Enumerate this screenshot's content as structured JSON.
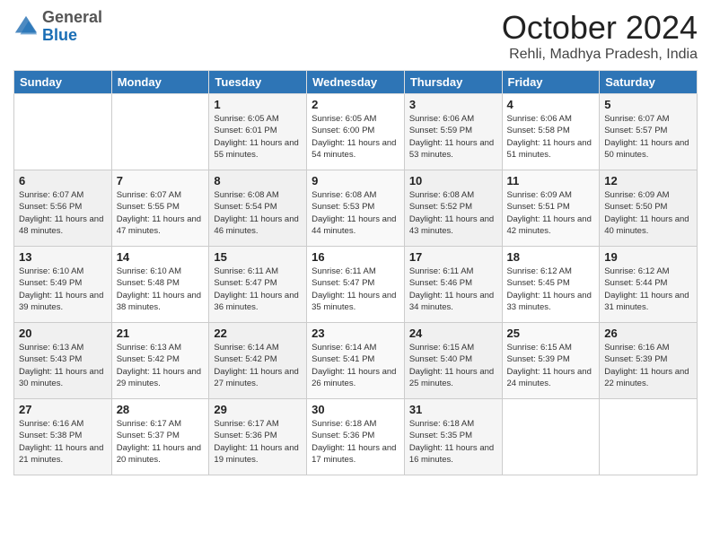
{
  "header": {
    "logo": {
      "general": "General",
      "blue": "Blue"
    },
    "title": "October 2024",
    "subtitle": "Rehli, Madhya Pradesh, India"
  },
  "days_of_week": [
    "Sunday",
    "Monday",
    "Tuesday",
    "Wednesday",
    "Thursday",
    "Friday",
    "Saturday"
  ],
  "weeks": [
    [
      {
        "day": "",
        "info": ""
      },
      {
        "day": "",
        "info": ""
      },
      {
        "day": "1",
        "info": "Sunrise: 6:05 AM\nSunset: 6:01 PM\nDaylight: 11 hours and 55 minutes."
      },
      {
        "day": "2",
        "info": "Sunrise: 6:05 AM\nSunset: 6:00 PM\nDaylight: 11 hours and 54 minutes."
      },
      {
        "day": "3",
        "info": "Sunrise: 6:06 AM\nSunset: 5:59 PM\nDaylight: 11 hours and 53 minutes."
      },
      {
        "day": "4",
        "info": "Sunrise: 6:06 AM\nSunset: 5:58 PM\nDaylight: 11 hours and 51 minutes."
      },
      {
        "day": "5",
        "info": "Sunrise: 6:07 AM\nSunset: 5:57 PM\nDaylight: 11 hours and 50 minutes."
      }
    ],
    [
      {
        "day": "6",
        "info": "Sunrise: 6:07 AM\nSunset: 5:56 PM\nDaylight: 11 hours and 48 minutes."
      },
      {
        "day": "7",
        "info": "Sunrise: 6:07 AM\nSunset: 5:55 PM\nDaylight: 11 hours and 47 minutes."
      },
      {
        "day": "8",
        "info": "Sunrise: 6:08 AM\nSunset: 5:54 PM\nDaylight: 11 hours and 46 minutes."
      },
      {
        "day": "9",
        "info": "Sunrise: 6:08 AM\nSunset: 5:53 PM\nDaylight: 11 hours and 44 minutes."
      },
      {
        "day": "10",
        "info": "Sunrise: 6:08 AM\nSunset: 5:52 PM\nDaylight: 11 hours and 43 minutes."
      },
      {
        "day": "11",
        "info": "Sunrise: 6:09 AM\nSunset: 5:51 PM\nDaylight: 11 hours and 42 minutes."
      },
      {
        "day": "12",
        "info": "Sunrise: 6:09 AM\nSunset: 5:50 PM\nDaylight: 11 hours and 40 minutes."
      }
    ],
    [
      {
        "day": "13",
        "info": "Sunrise: 6:10 AM\nSunset: 5:49 PM\nDaylight: 11 hours and 39 minutes."
      },
      {
        "day": "14",
        "info": "Sunrise: 6:10 AM\nSunset: 5:48 PM\nDaylight: 11 hours and 38 minutes."
      },
      {
        "day": "15",
        "info": "Sunrise: 6:11 AM\nSunset: 5:47 PM\nDaylight: 11 hours and 36 minutes."
      },
      {
        "day": "16",
        "info": "Sunrise: 6:11 AM\nSunset: 5:47 PM\nDaylight: 11 hours and 35 minutes."
      },
      {
        "day": "17",
        "info": "Sunrise: 6:11 AM\nSunset: 5:46 PM\nDaylight: 11 hours and 34 minutes."
      },
      {
        "day": "18",
        "info": "Sunrise: 6:12 AM\nSunset: 5:45 PM\nDaylight: 11 hours and 33 minutes."
      },
      {
        "day": "19",
        "info": "Sunrise: 6:12 AM\nSunset: 5:44 PM\nDaylight: 11 hours and 31 minutes."
      }
    ],
    [
      {
        "day": "20",
        "info": "Sunrise: 6:13 AM\nSunset: 5:43 PM\nDaylight: 11 hours and 30 minutes."
      },
      {
        "day": "21",
        "info": "Sunrise: 6:13 AM\nSunset: 5:42 PM\nDaylight: 11 hours and 29 minutes."
      },
      {
        "day": "22",
        "info": "Sunrise: 6:14 AM\nSunset: 5:42 PM\nDaylight: 11 hours and 27 minutes."
      },
      {
        "day": "23",
        "info": "Sunrise: 6:14 AM\nSunset: 5:41 PM\nDaylight: 11 hours and 26 minutes."
      },
      {
        "day": "24",
        "info": "Sunrise: 6:15 AM\nSunset: 5:40 PM\nDaylight: 11 hours and 25 minutes."
      },
      {
        "day": "25",
        "info": "Sunrise: 6:15 AM\nSunset: 5:39 PM\nDaylight: 11 hours and 24 minutes."
      },
      {
        "day": "26",
        "info": "Sunrise: 6:16 AM\nSunset: 5:39 PM\nDaylight: 11 hours and 22 minutes."
      }
    ],
    [
      {
        "day": "27",
        "info": "Sunrise: 6:16 AM\nSunset: 5:38 PM\nDaylight: 11 hours and 21 minutes."
      },
      {
        "day": "28",
        "info": "Sunrise: 6:17 AM\nSunset: 5:37 PM\nDaylight: 11 hours and 20 minutes."
      },
      {
        "day": "29",
        "info": "Sunrise: 6:17 AM\nSunset: 5:36 PM\nDaylight: 11 hours and 19 minutes."
      },
      {
        "day": "30",
        "info": "Sunrise: 6:18 AM\nSunset: 5:36 PM\nDaylight: 11 hours and 17 minutes."
      },
      {
        "day": "31",
        "info": "Sunrise: 6:18 AM\nSunset: 5:35 PM\nDaylight: 11 hours and 16 minutes."
      },
      {
        "day": "",
        "info": ""
      },
      {
        "day": "",
        "info": ""
      }
    ]
  ]
}
